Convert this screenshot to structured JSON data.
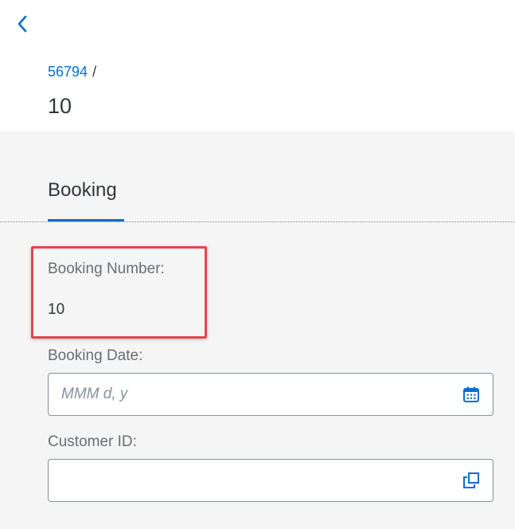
{
  "header": {
    "back_icon": "chevron-left-icon",
    "breadcrumb": {
      "link_text": "56794",
      "separator": "/"
    },
    "title": "10"
  },
  "tabs": [
    {
      "label": "Booking",
      "selected": true
    }
  ],
  "form": {
    "booking_number": {
      "label": "Booking Number:",
      "value": "10"
    },
    "booking_date": {
      "label": "Booking Date:",
      "placeholder": "MMM d, y",
      "icon": "calendar-icon"
    },
    "customer_id": {
      "label": "Customer ID:",
      "value": "",
      "icon": "value-help-icon"
    }
  },
  "colors": {
    "accent": "#0a6ed1",
    "highlight": "#e0484b",
    "text": "#32363a",
    "label": "#6a6d70"
  }
}
